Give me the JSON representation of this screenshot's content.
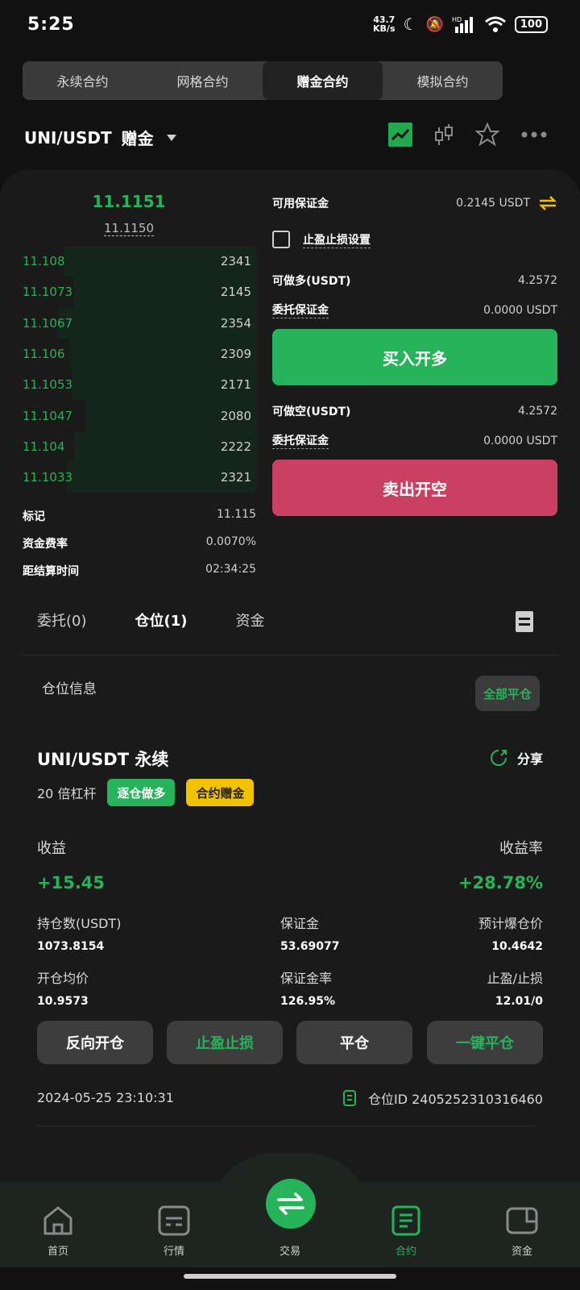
{
  "status": {
    "time": "5:25",
    "speed_top": "43.7",
    "speed_bottom": "KB/s",
    "hd": "HD",
    "battery": "100"
  },
  "tabs": [
    {
      "label": "永续合约"
    },
    {
      "label": "网格合约"
    },
    {
      "label": "赠金合约"
    },
    {
      "label": "模拟合约"
    }
  ],
  "pair": {
    "symbol": "UNI/USDT",
    "type": "赠金"
  },
  "orderbook": {
    "last_price": "11.1151",
    "mark_price": "11.1150",
    "rows": [
      {
        "price": "11.108",
        "qty": "2341",
        "depth": 0.82
      },
      {
        "price": "11.1073",
        "qty": "2145",
        "depth": 0.78
      },
      {
        "price": "11.1067",
        "qty": "2354",
        "depth": 0.85
      },
      {
        "price": "11.106",
        "qty": "2309",
        "depth": 0.8
      },
      {
        "price": "11.1053",
        "qty": "2171",
        "depth": 0.79
      },
      {
        "price": "11.1047",
        "qty": "2080",
        "depth": 0.73
      },
      {
        "price": "11.104",
        "qty": "2222",
        "depth": 0.78
      },
      {
        "price": "11.1033",
        "qty": "2321",
        "depth": 0.81
      }
    ],
    "stats": [
      {
        "label": "标记",
        "value": "11.115"
      },
      {
        "label": "资金费率",
        "value": "0.0070%"
      },
      {
        "label": "距结算时间",
        "value": "02:34:25"
      }
    ]
  },
  "form": {
    "avail_label": "可用保证金",
    "avail_value": "0.2145 USDT",
    "tpsl_label": "止盈止损设置",
    "long_label": "可做多(USDT)",
    "long_value": "4.2572",
    "long_margin_label": "委托保证金",
    "long_margin_value": "0.0000 USDT",
    "buy_btn": "买入开多",
    "short_label": "可做空(USDT)",
    "short_value": "4.2572",
    "short_margin_label": "委托保证金",
    "short_margin_value": "0.0000 USDT",
    "sell_btn": "卖出开空"
  },
  "ptabs": [
    {
      "label": "委托(0)"
    },
    {
      "label": "仓位(1)"
    },
    {
      "label": "资金"
    }
  ],
  "position": {
    "section_title": "仓位信息",
    "close_all": "全部平仓",
    "title": "UNI/USDT 永续",
    "share": "分享",
    "leverage": "20 倍杠杆",
    "badge1": "逐仓做多",
    "badge2": "合约赠金",
    "pnl_label": "收益",
    "pnl_rate_label": "收益率",
    "pnl": "+15.45",
    "pnl_rate": "+28.78%",
    "hold_label": "持仓数(USDT)",
    "hold_value": "1073.8154",
    "margin_label": "保证金",
    "margin_value": "53.69077",
    "liq_label": "预计爆仓价",
    "liq_value": "10.4642",
    "open_label": "开仓均价",
    "open_value": "10.9573",
    "margin_rate_label": "保证金率",
    "margin_rate_value": "126.95%",
    "tpsl_label": "止盈/止损",
    "tpsl_value": "12.01/0",
    "btn_reverse": "反向开仓",
    "btn_tpsl": "止盈止损",
    "btn_close": "平仓",
    "btn_oneclick": "一键平仓",
    "time": "2024-05-25 23:10:31",
    "position_id": "仓位ID 2405252310316460"
  },
  "nav": [
    {
      "label": "首页"
    },
    {
      "label": "行情"
    },
    {
      "label": "交易"
    },
    {
      "label": "合约"
    },
    {
      "label": "资金"
    }
  ],
  "colors": {
    "green": "#27b35a",
    "red": "#d6456a",
    "gold": "#f2c200"
  }
}
